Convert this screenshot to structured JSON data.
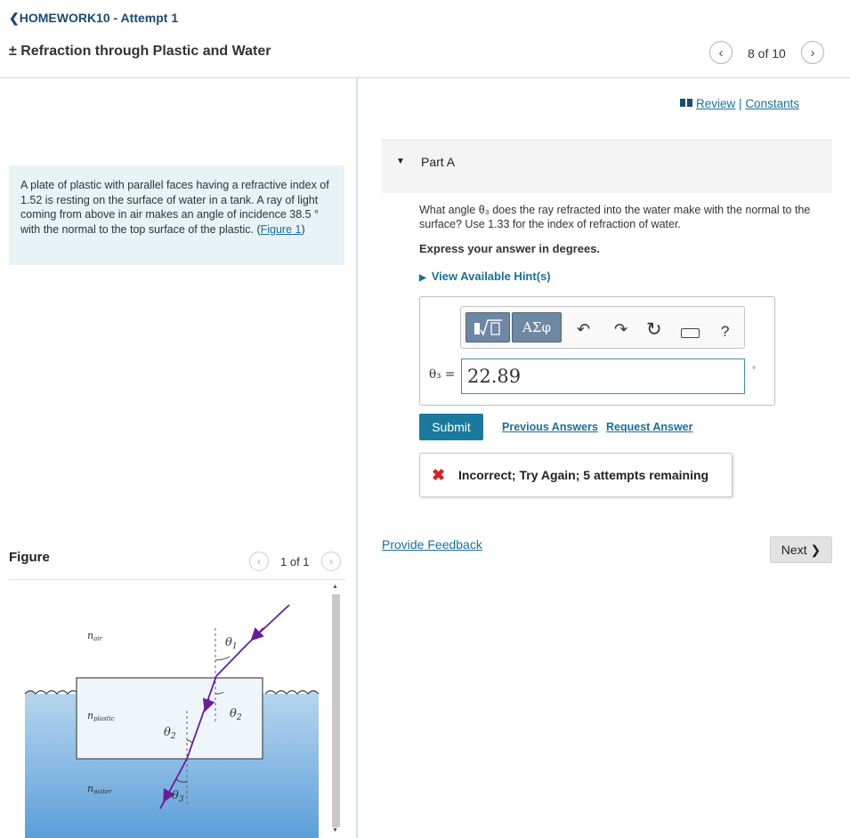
{
  "header": {
    "back_label": "❮HOMEWORK10 - Attempt 1",
    "title": "± Refraction through Plastic and Water",
    "item_counter": "8 of 10"
  },
  "problem": {
    "text": "A plate of plastic with parallel faces having a refractive index of 1.52 is resting on the surface of water in a tank. A ray of light coming from above in air makes an angle of incidence 38.5 ° with the normal to the top surface of the plastic.",
    "figure_link": "Figure 1",
    "link_prefix": "(",
    "link_suffix": ")"
  },
  "figure": {
    "title": "Figure",
    "counter": "1 of 1",
    "labels": {
      "n_air": "n",
      "n_air_sub": "air",
      "n_plastic": "n",
      "n_plastic_sub": "plastic",
      "n_water": "n",
      "n_water_sub": "water",
      "theta": "θ",
      "sub1": "1",
      "sub2": "2",
      "sub3": "3"
    },
    "colors": {
      "water": "#5b9fd9",
      "ray": "#6a1b9a",
      "plastic": "#eef5fb"
    }
  },
  "links": {
    "review": "Review",
    "separator": "|",
    "constants": "Constants"
  },
  "part": {
    "label": "Part A",
    "question": "What angle θ₃ does the ray refracted into the water make with the normal to the surface? Use 1.33 for the index of refraction of water.",
    "instruction": "Express your answer in degrees.",
    "hints": "View Available Hint(s)"
  },
  "answer": {
    "symbols_button": "ΑΣφ",
    "help": "?",
    "variable_label": "θ₃ =",
    "value": "22.89",
    "unit": "°"
  },
  "actions": {
    "submit": "Submit",
    "previous_answers": "Previous Answers",
    "request_answer": "Request Answer"
  },
  "feedback": {
    "icon": "✖",
    "text": "Incorrect; Try Again; 5 attempts remaining"
  },
  "footer": {
    "provide_feedback": "Provide Feedback",
    "next": "Next ❯"
  }
}
